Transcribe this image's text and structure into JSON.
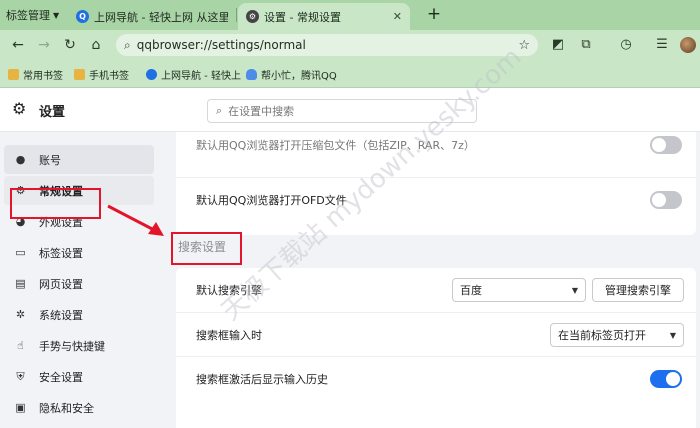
{
  "browser": {
    "tab_manager_label": "标签管理",
    "tabs": [
      {
        "title": "上网导航 - 轻快上网 从这里开始"
      },
      {
        "title": "设置 - 常规设置"
      }
    ],
    "url": "qqbrowser://settings/normal",
    "bookmarks": [
      {
        "label": "常用书签",
        "icon": "folder-icon"
      },
      {
        "label": "手机书签",
        "icon": "folder-icon"
      },
      {
        "label": "上网导航 - 轻快上",
        "icon": "globe-icon"
      },
      {
        "label": "帮小忙，腾讯QQ",
        "icon": "cloud-icon"
      }
    ]
  },
  "header": {
    "title": "设置",
    "search_placeholder": "在设置中搜索"
  },
  "sidebar": {
    "items": [
      {
        "label": "账号",
        "icon": "person-icon"
      },
      {
        "label": "常规设置",
        "icon": "gear-icon"
      },
      {
        "label": "外观设置",
        "icon": "palette-icon"
      },
      {
        "label": "标签设置",
        "icon": "tab-window-icon"
      },
      {
        "label": "网页设置",
        "icon": "webpage-icon"
      },
      {
        "label": "系统设置",
        "icon": "system-gears-icon"
      },
      {
        "label": "手势与快捷键",
        "icon": "hand-icon"
      },
      {
        "label": "安全设置",
        "icon": "shield-icon"
      },
      {
        "label": "隐私和安全",
        "icon": "lock-icon"
      }
    ]
  },
  "content": {
    "partial_row_label": "默认用QQ浏览器打开压缩包文件（包括ZIP、RAR、7z）",
    "ofd_row_label": "默认用QQ浏览器打开OFD文件",
    "ofd_toggle": "off",
    "search_section_title": "搜索设置",
    "search_engine": {
      "label": "默认搜索引擎",
      "value": "百度",
      "manage_button": "管理搜索引擎"
    },
    "search_input": {
      "label": "搜索框输入时",
      "value": "在当前标签页打开"
    },
    "search_history": {
      "label": "搜索框激活后显示输入历史",
      "toggle": "on"
    }
  },
  "watermark": "天极下载站 mydown.yesky.com",
  "colors": {
    "accent": "#1e6ef0",
    "highlight_box": "#e3152b",
    "chrome": "#c9e7c7"
  }
}
